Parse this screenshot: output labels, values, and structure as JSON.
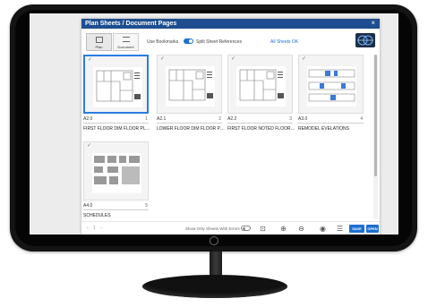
{
  "dialog": {
    "title": "Plan Sheets / Document Pages",
    "close_glyph": "×"
  },
  "toolbar": {
    "mode_buttons": [
      {
        "label": "Plan",
        "icon": "plan-icon",
        "active": true
      },
      {
        "label": "Document",
        "icon": "document-icon",
        "active": false
      }
    ],
    "use_bookmarks_label": "Use Bookmarks",
    "split_sheet_label": "Split Sheet References",
    "split_sheet_enabled": true,
    "all_sheets_link": "All Sheets OK",
    "logo_icon": "brand-logo-icon"
  },
  "sheets": [
    {
      "number": "A2.0",
      "index": "1",
      "title": "FIRST FLOOR DIM FLOOR PLAN",
      "selected": true
    },
    {
      "number": "A2.1",
      "index": "2",
      "title": "LOWER FLOOR DIM FLOOR PLAN",
      "selected": false
    },
    {
      "number": "A2.2",
      "index": "3",
      "title": "FIRST FLOOR NOTED FLOOR PLAN",
      "selected": false
    },
    {
      "number": "A3.0",
      "index": "4",
      "title": "REMODEL EVELATIONS",
      "selected": false
    },
    {
      "number": "A4.0",
      "index": "5",
      "title": "SCHEDULES",
      "selected": false
    }
  ],
  "footer": {
    "pager": "‹ 1 ›",
    "show_errors_label": "Show Only Sheets With Errors",
    "show_errors_enabled": false,
    "tools": [
      "fit-icon",
      "zoom-in-icon",
      "zoom-out-icon",
      "target-icon",
      "list-check-icon"
    ],
    "save_label": "SAVE",
    "open_label": "OPEN"
  },
  "colors": {
    "titlebar": "#1e4e8f",
    "accent": "#1f6fd1",
    "selection": "#2b7de0"
  }
}
